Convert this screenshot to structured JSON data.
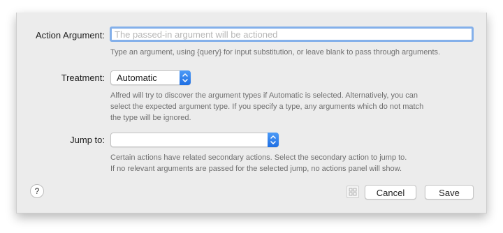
{
  "action_argument": {
    "label": "Action Argument:",
    "placeholder": "The passed-in argument will be actioned",
    "value": "",
    "hint": "Type an argument, using {query} for input substitution, or leave blank to pass through arguments."
  },
  "treatment": {
    "label": "Treatment:",
    "selected": "Automatic",
    "hint_lines": [
      "Alfred will try to discover the argument types if Automatic is selected. Alternatively, you can",
      "select the expected argument type. If you specify a type, any arguments which do not match",
      "the type will be ignored."
    ]
  },
  "jump_to": {
    "label": "Jump to:",
    "selected": "",
    "hint_lines": [
      "Certain actions have related secondary actions. Select the secondary action to jump to.",
      "If no relevant arguments are passed for the selected jump, no actions panel will show."
    ]
  },
  "footer": {
    "help_label": "?",
    "cancel_label": "Cancel",
    "save_label": "Save"
  },
  "colors": {
    "sheet_background": "#ececec",
    "focus_ring": "#84b0ea",
    "popup_accent": "#2a7cf0",
    "hint_text": "#6f6f6f",
    "placeholder_text": "#b7b7b7"
  },
  "icons": {
    "popup_arrows": "up-down-chevron-icon",
    "help": "question-mark-icon",
    "grid": "grid-icon"
  }
}
